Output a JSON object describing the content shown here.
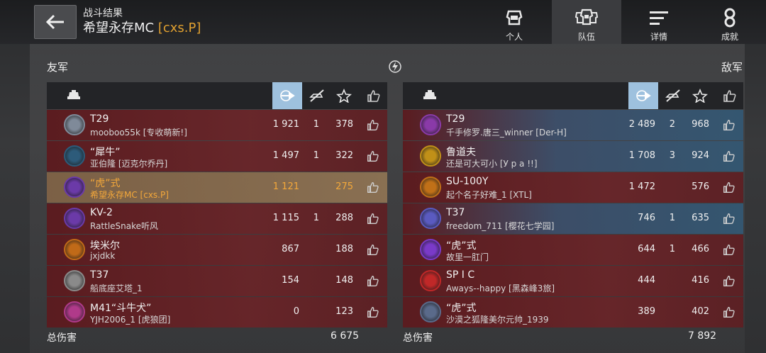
{
  "header": {
    "subtitle": "战斗结果",
    "player_name": "希望永存MC",
    "player_clan": "[cxs.P]"
  },
  "tabs": [
    {
      "label": "个人",
      "icon": "player-helmet-icon"
    },
    {
      "label": "队伍",
      "icon": "team-helmets-icon"
    },
    {
      "label": "详情",
      "icon": "details-lines-icon"
    },
    {
      "label": "成就",
      "icon": "medal-icon"
    }
  ],
  "allies": {
    "title": "友军",
    "rows": [
      {
        "tank": "T29",
        "player": "mooboo55k [专收萌新!]",
        "damage": "1 921",
        "kills": "1",
        "xp": "378",
        "badge_color": "#7f8a99"
      },
      {
        "tank": "“犀牛”",
        "player": "亚伯隆 [迈克尔乔丹]",
        "damage": "1 497",
        "kills": "1",
        "xp": "322",
        "badge_color": "#2d5b7a"
      },
      {
        "tank": "“虎”式",
        "player": "希望永存MC [cxs.P]",
        "damage": "1 121",
        "kills": "",
        "xp": "275",
        "badge_color": "#6b3aa8"
      },
      {
        "tank": "KV-2",
        "player": "RattleSnake听风",
        "damage": "1 115",
        "kills": "1",
        "xp": "288",
        "badge_color": "#6b3aa8"
      },
      {
        "tank": "埃米尔",
        "player": "jxjdkk",
        "damage": "867",
        "kills": "",
        "xp": "188",
        "badge_color": "#c06a18"
      },
      {
        "tank": "T37",
        "player": "船底座艾塔_1",
        "damage": "154",
        "kills": "",
        "xp": "148",
        "badge_color": "#8a8a8a"
      },
      {
        "tank": "M41“斗牛犬”",
        "player": "YJH2006_1 [虎狼团]",
        "damage": "0",
        "kills": "",
        "xp": "123",
        "badge_color": "#b03a8a"
      }
    ],
    "total_label": "总伤害",
    "total_value": "6 675"
  },
  "enemies": {
    "title": "敌军",
    "rows": [
      {
        "tank": "T29",
        "player": "千手修罗.唐三_winner [Der-H]",
        "damage": "2 489",
        "kills": "2",
        "xp": "968",
        "badge_color": "#8a3aa8"
      },
      {
        "tank": "鲁道夫",
        "player": "还是可大可小 [У р а !!]",
        "damage": "1 708",
        "kills": "3",
        "xp": "924",
        "badge_color": "#c09018"
      },
      {
        "tank": "SU-100Y",
        "player": "起个名子好难_1 [XTL]",
        "damage": "1 472",
        "kills": "",
        "xp": "576",
        "badge_color": "#c07018"
      },
      {
        "tank": "T37",
        "player": "freedom_711 [樱花七学园]",
        "damage": "746",
        "kills": "1",
        "xp": "635",
        "badge_color": "#5a5ac0"
      },
      {
        "tank": "“虎”式",
        "player": "故里一肛门",
        "damage": "644",
        "kills": "1",
        "xp": "466",
        "badge_color": "#7a3ac8"
      },
      {
        "tank": "SP I C",
        "player": "Aways--happy [黑森峰3旅]",
        "damage": "444",
        "kills": "",
        "xp": "416",
        "badge_color": "#c02828"
      },
      {
        "tank": "“虎”式",
        "player": "沙漠之狐隆美尔元帅_1939",
        "damage": "389",
        "kills": "",
        "xp": "402",
        "badge_color": "#5a6a8a"
      }
    ],
    "total_label": "总伤害",
    "total_value": "7 892"
  },
  "columns": [
    "tank-icon",
    "damage-icon",
    "kills-icon",
    "xp-star-icon",
    "like-icon"
  ]
}
